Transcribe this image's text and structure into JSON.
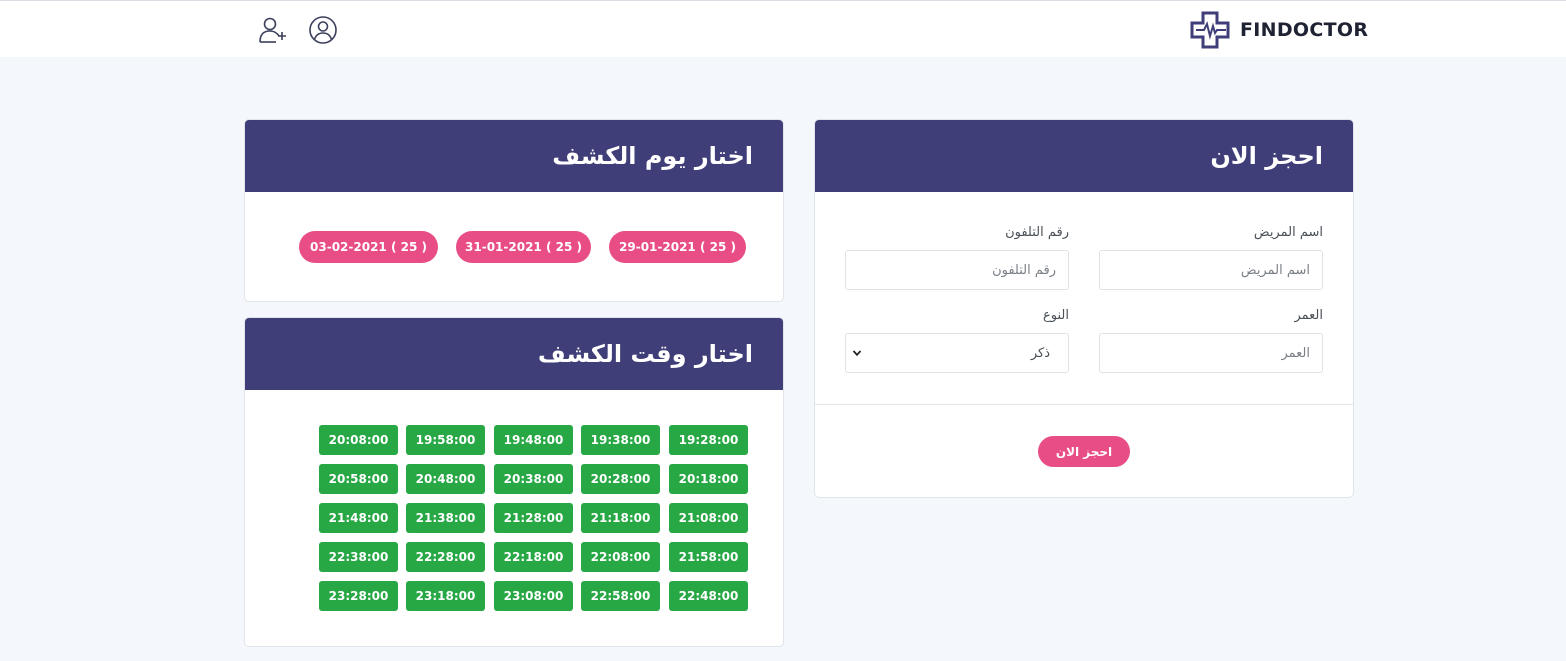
{
  "header": {
    "brand": "FINDOCTOR",
    "icons": {
      "logo": "medical-cross-logo",
      "add_user": "user-plus-icon",
      "profile": "user-circle-icon"
    }
  },
  "booking": {
    "title": "احجز الان",
    "name_label": "اسم المريض",
    "name_placeholder": "اسم المريض",
    "phone_label": "رقم التلفون",
    "phone_placeholder": "رقم التلفون",
    "age_label": "العمر",
    "age_placeholder": "العمر",
    "gender_label": "النوع",
    "gender_value": "ذكر",
    "submit": "احجز الان"
  },
  "days": {
    "title": "اختار يوم الكشف",
    "items": [
      "29-01-2021 ( 25 )",
      "31-01-2021 ( 25 )",
      "03-02-2021 ( 25 )"
    ]
  },
  "times": {
    "title": "اختار وقت الكشف",
    "rows": [
      [
        "19:28:00",
        "19:38:00",
        "19:48:00",
        "19:58:00",
        "20:08:00"
      ],
      [
        "20:18:00",
        "20:28:00",
        "20:38:00",
        "20:48:00",
        "20:58:00"
      ],
      [
        "21:08:00",
        "21:18:00",
        "21:28:00",
        "21:38:00",
        "21:48:00"
      ],
      [
        "21:58:00",
        "22:08:00",
        "22:18:00",
        "22:28:00",
        "22:38:00"
      ],
      [
        "22:48:00",
        "22:58:00",
        "23:08:00",
        "23:18:00",
        "23:28:00"
      ]
    ]
  },
  "colors": {
    "header": "#3f3e78",
    "accent": "#e84d86",
    "time_slot": "#28a745"
  }
}
